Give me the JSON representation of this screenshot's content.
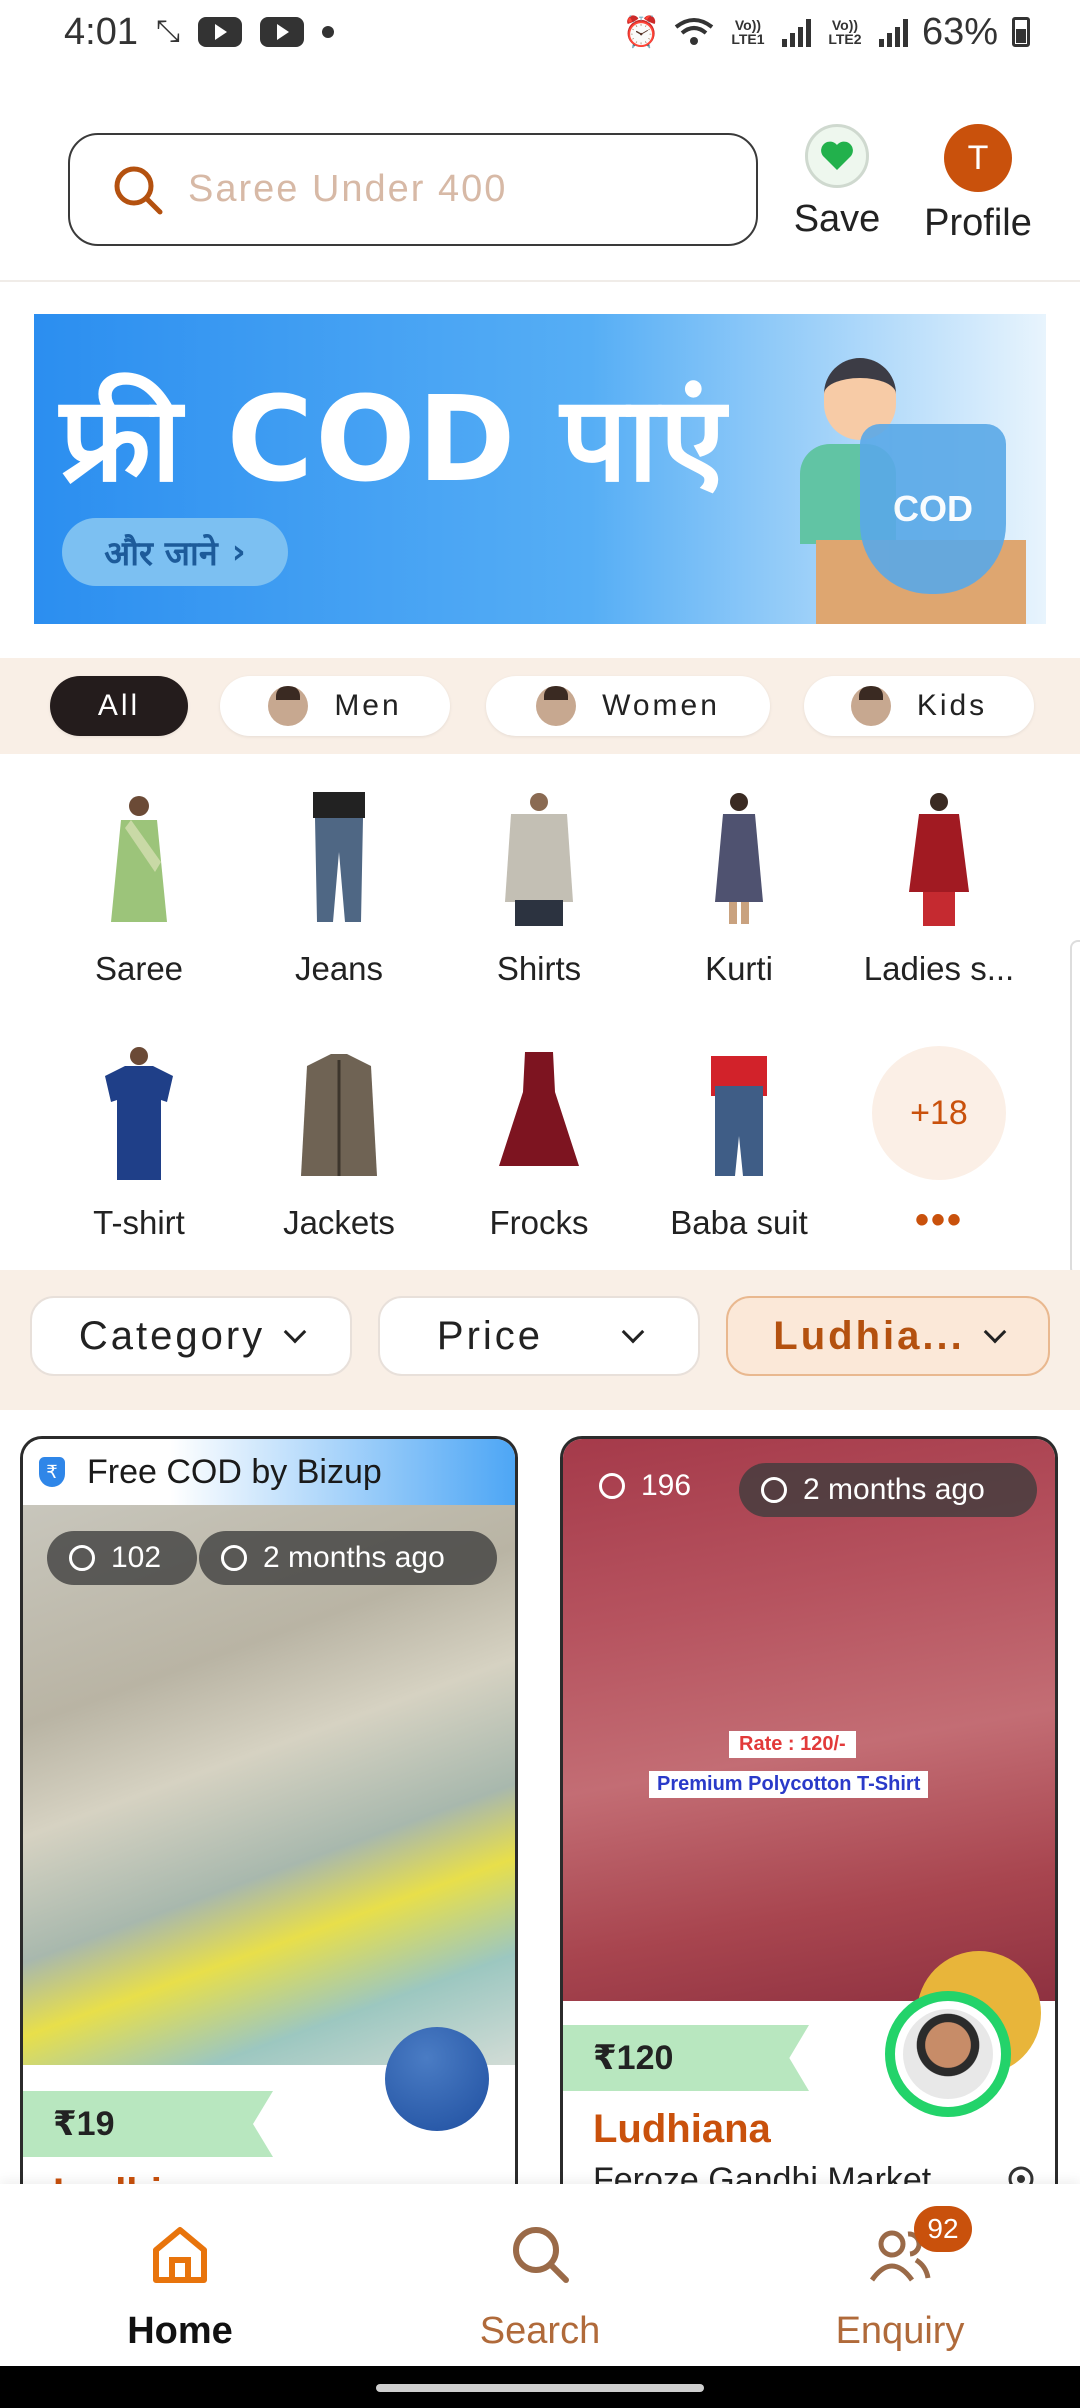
{
  "status_bar": {
    "time": "4:01",
    "lte1": "Vo)) LTE1",
    "lte2": "Vo)) LTE2",
    "battery": "63%"
  },
  "header": {
    "search_placeholder": "Saree Under 400",
    "save_label": "Save",
    "profile_label": "Profile",
    "profile_initial": "T"
  },
  "banner": {
    "title": "फ्री COD पाएं",
    "button_label": "और जाने",
    "shield_text": "COD"
  },
  "audience_tabs": [
    {
      "label": "All",
      "active": true
    },
    {
      "label": "Men",
      "active": false
    },
    {
      "label": "Women",
      "active": false
    },
    {
      "label": "Kids",
      "active": false
    }
  ],
  "categories": [
    {
      "label": "Saree",
      "icon": "saree-image"
    },
    {
      "label": "Jeans",
      "icon": "jeans-image"
    },
    {
      "label": "Shirts",
      "icon": "shirt-image"
    },
    {
      "label": "Kurti",
      "icon": "kurti-image"
    },
    {
      "label": "Ladies s...",
      "icon": "ladies-suit-image"
    },
    {
      "label": "T-shirt",
      "icon": "tshirt-image"
    },
    {
      "label": "Jackets",
      "icon": "jacket-image"
    },
    {
      "label": "Frocks",
      "icon": "frock-image"
    },
    {
      "label": "Baba suit",
      "icon": "baba-suit-image"
    }
  ],
  "more_categories": {
    "count": "+18",
    "dots": "•••"
  },
  "filters": {
    "category": "Category",
    "price": "Price",
    "location": "Ludhia..."
  },
  "cards": [
    {
      "promo": "Free COD by Bizup",
      "views": "102",
      "time": "2 months ago",
      "price": "₹19",
      "city": "Ludhiana"
    },
    {
      "views": "196",
      "time": "2 months ago",
      "image_text_1": "Rate : 120/-",
      "image_text_2": "Premium Polycotton T-Shirt",
      "price": "₹120",
      "city": "Ludhiana",
      "market": "Feroze Gandhi Market"
    }
  ],
  "bottom_nav": [
    {
      "label": "Home",
      "active": true
    },
    {
      "label": "Search",
      "active": false
    },
    {
      "label": "Enquiry",
      "active": false,
      "badge": "92"
    }
  ],
  "colors": {
    "accent": "#c9510c",
    "tab_strip_bg": "#f9efe6",
    "price_tag": "#b8e7bf",
    "seller_ring": "#23d36a"
  }
}
